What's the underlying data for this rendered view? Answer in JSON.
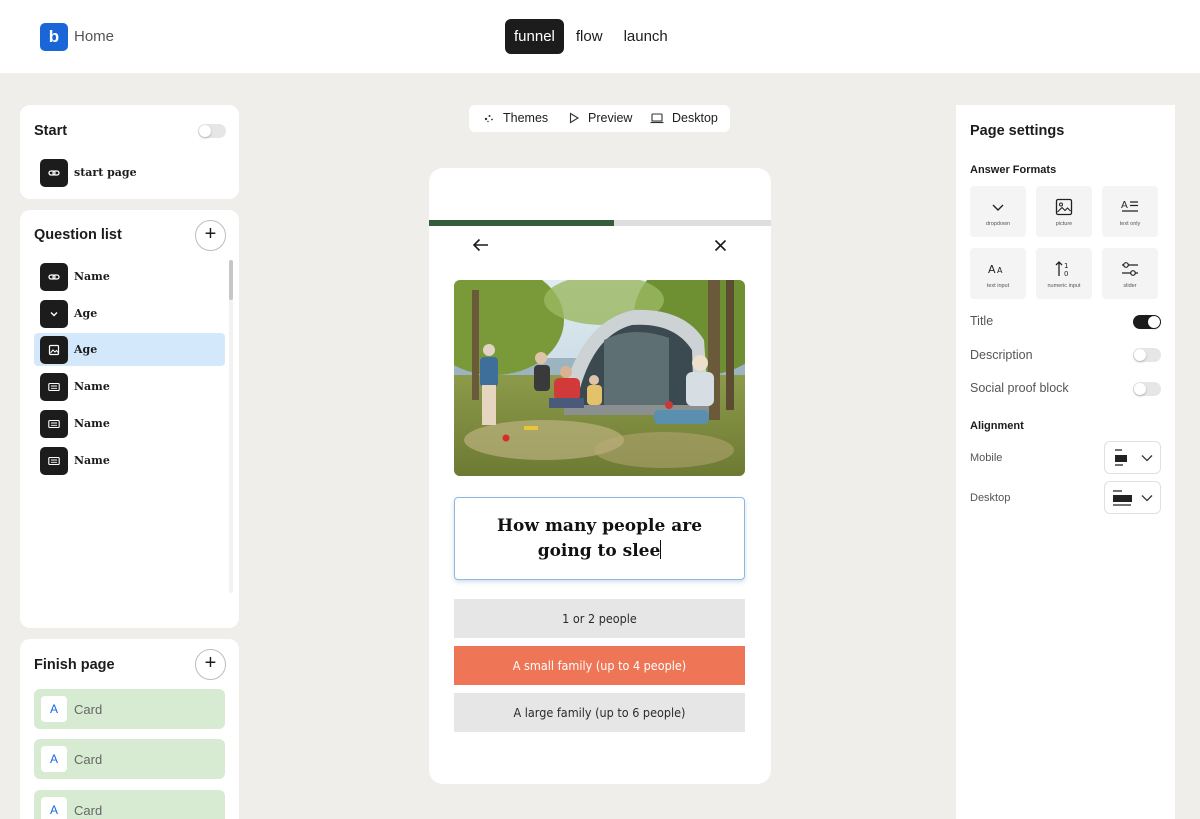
{
  "header": {
    "logo_letter": "b",
    "home_label": "Home",
    "tabs": [
      {
        "label": "funnel",
        "active": true
      },
      {
        "label": "flow",
        "active": false
      },
      {
        "label": "launch",
        "active": false
      }
    ]
  },
  "start_panel": {
    "title": "Start",
    "toggle_on": false,
    "item": {
      "label": "start page",
      "icon": "link-icon"
    }
  },
  "question_list": {
    "title": "Question list",
    "items": [
      {
        "label": "Name",
        "icon": "link-icon",
        "selected": false
      },
      {
        "label": "Age",
        "icon": "chevron-down-icon",
        "selected": false
      },
      {
        "label": "Age",
        "icon": "image-icon",
        "selected": true
      },
      {
        "label": "Name",
        "icon": "keyboard-icon",
        "selected": false
      },
      {
        "label": "Name",
        "icon": "keyboard-icon",
        "selected": false
      },
      {
        "label": "Name",
        "icon": "keyboard-icon",
        "selected": false
      }
    ]
  },
  "finish_panel": {
    "title": "Finish page",
    "cards": [
      {
        "letter": "A",
        "label": "Card"
      },
      {
        "letter": "A",
        "label": "Card"
      },
      {
        "letter": "A",
        "label": "Card"
      }
    ]
  },
  "toolbar": {
    "themes_label": "Themes",
    "preview_label": "Preview",
    "desktop_label": "Desktop"
  },
  "preview": {
    "progress_fraction": 0.54,
    "question": "How many people are going to slee",
    "answers": [
      {
        "label": "1 or 2 people",
        "highlighted": false
      },
      {
        "label": "A small family (up to 4 people)",
        "highlighted": true
      },
      {
        "label": "A large family (up to 6 people)",
        "highlighted": false
      }
    ],
    "colors": {
      "progress": "#345d3b",
      "highlight": "#ee7657"
    }
  },
  "page_settings": {
    "title": "Page settings",
    "answer_formats_label": "Answer Formats",
    "formats": [
      {
        "label": "dropdown",
        "icon": "chevron-down-icon"
      },
      {
        "label": "picture",
        "icon": "image-icon"
      },
      {
        "label": "text only",
        "icon": "text-icon"
      },
      {
        "label": "text input",
        "icon": "font-size-icon"
      },
      {
        "label": "numeric input",
        "icon": "sort-numeric-icon"
      },
      {
        "label": "slider",
        "icon": "slider-icon"
      }
    ],
    "toggles": [
      {
        "label": "Title",
        "on": true
      },
      {
        "label": "Description",
        "on": false
      },
      {
        "label": "Social proof block",
        "on": false
      }
    ],
    "alignment_label": "Alignment",
    "alignment": [
      {
        "label": "Mobile"
      },
      {
        "label": "Desktop"
      }
    ]
  }
}
